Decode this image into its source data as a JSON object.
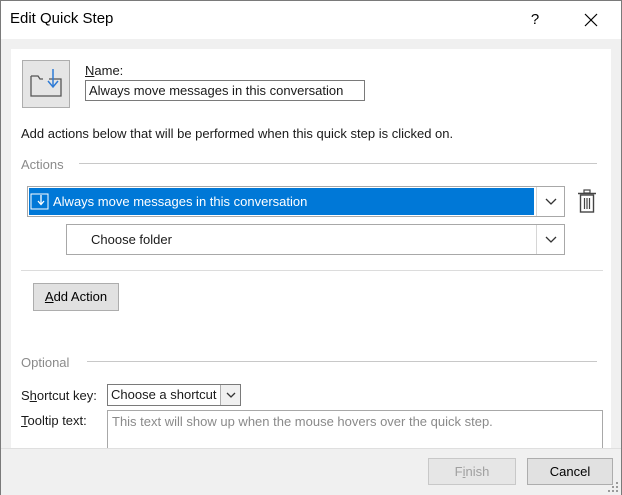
{
  "window": {
    "title": "Edit Quick Step",
    "help_label": "?"
  },
  "step": {
    "icon": "move-to-folder-icon",
    "name_label": "Name:",
    "name_value": "Always move messages in this conversation"
  },
  "description": "Add actions below that will be performed when this quick step is clicked on.",
  "actions": {
    "group_label": "Actions",
    "selected_action": "Always move messages in this conversation",
    "folder_value": "Choose folder",
    "add_button": "Add Action"
  },
  "optional": {
    "group_label": "Optional",
    "shortcut_label": "Shortcut key:",
    "shortcut_value": "Choose a shortcut",
    "tooltip_label": "Tooltip text:",
    "tooltip_placeholder": "This text will show up when the mouse hovers over the quick step."
  },
  "footer": {
    "finish_label": "Finish",
    "cancel_label": "Cancel"
  },
  "colors": {
    "selection": "#0078d7",
    "dialog_bg": "#f0f0f0"
  }
}
